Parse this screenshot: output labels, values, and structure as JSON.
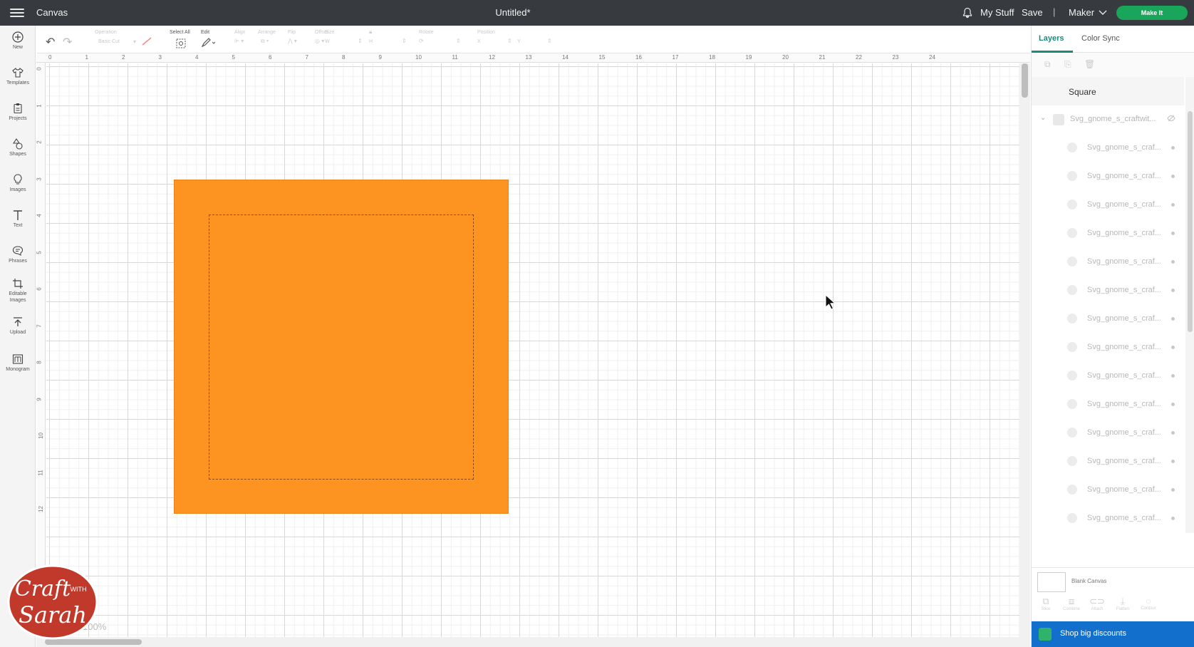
{
  "topbar": {
    "app_title": "Canvas",
    "doc_title": "Untitled*",
    "my_stuff": "My Stuff",
    "save": "Save",
    "separator": "|",
    "machine": "Maker",
    "make_it": "Make It"
  },
  "toolbar": {
    "operation_label": "Operation",
    "operation_value": "Basic Cut",
    "select_all_label": "Select All",
    "edit_label": "Edit",
    "align_label": "Align",
    "arrange_label": "Arrange",
    "flip_label": "Flip",
    "offset_label": "Offset",
    "size_label": "Size",
    "size_w": "W",
    "size_h": "H",
    "rotate_label": "Rotate",
    "position_label": "Position",
    "pos_x": "X",
    "pos_y": "Y"
  },
  "sidebar": {
    "items": [
      {
        "label": "New",
        "icon": "plus-circle-icon"
      },
      {
        "label": "Templates",
        "icon": "shirt-icon"
      },
      {
        "label": "Projects",
        "icon": "clipboard-icon"
      },
      {
        "label": "Shapes",
        "icon": "shapes-icon"
      },
      {
        "label": "Images",
        "icon": "lightbulb-icon"
      },
      {
        "label": "Text",
        "icon": "text-icon"
      },
      {
        "label": "Phrases",
        "icon": "speech-bubble-icon"
      },
      {
        "label": "Editable Images",
        "icon": "crop-icon"
      },
      {
        "label": "Upload",
        "icon": "upload-icon"
      },
      {
        "label": "Monogram",
        "icon": "monogram-icon"
      }
    ]
  },
  "ruler": {
    "top": [
      "0",
      "1",
      "2",
      "3",
      "4",
      "5",
      "6",
      "7",
      "8",
      "9",
      "10",
      "11",
      "12",
      "13",
      "14",
      "15",
      "16",
      "17",
      "18",
      "19",
      "20",
      "21",
      "22",
      "23",
      "24"
    ],
    "left": [
      "0",
      "1",
      "2",
      "3",
      "4",
      "5",
      "6",
      "7",
      "8",
      "9",
      "10",
      "11",
      "12"
    ]
  },
  "canvas": {
    "shape_color": "#fd9421",
    "zoom": "100%"
  },
  "right_panel": {
    "tabs": [
      "Layers",
      "Color Sync"
    ],
    "layer_selected": "Square",
    "group_name": "Svg_gnome_s_craftwit...",
    "layers": [
      "Svg_gnome_s_craf...",
      "Svg_gnome_s_craf...",
      "Svg_gnome_s_craf...",
      "Svg_gnome_s_craf...",
      "Svg_gnome_s_craf...",
      "Svg_gnome_s_craf...",
      "Svg_gnome_s_craf...",
      "Svg_gnome_s_craf...",
      "Svg_gnome_s_craf...",
      "Svg_gnome_s_craf...",
      "Svg_gnome_s_craf...",
      "Svg_gnome_s_craf...",
      "Svg_gnome_s_craf...",
      "Svg_gnome_s_craf..."
    ],
    "blank_canvas": "Blank Canvas",
    "bottom_tools": [
      "Slice",
      "Combine",
      "Attach",
      "Flatten",
      "Contour"
    ],
    "shop": "Shop big discounts"
  },
  "logo": {
    "line1": "Craft",
    "with": "WITH",
    "line2": "Sarah"
  }
}
